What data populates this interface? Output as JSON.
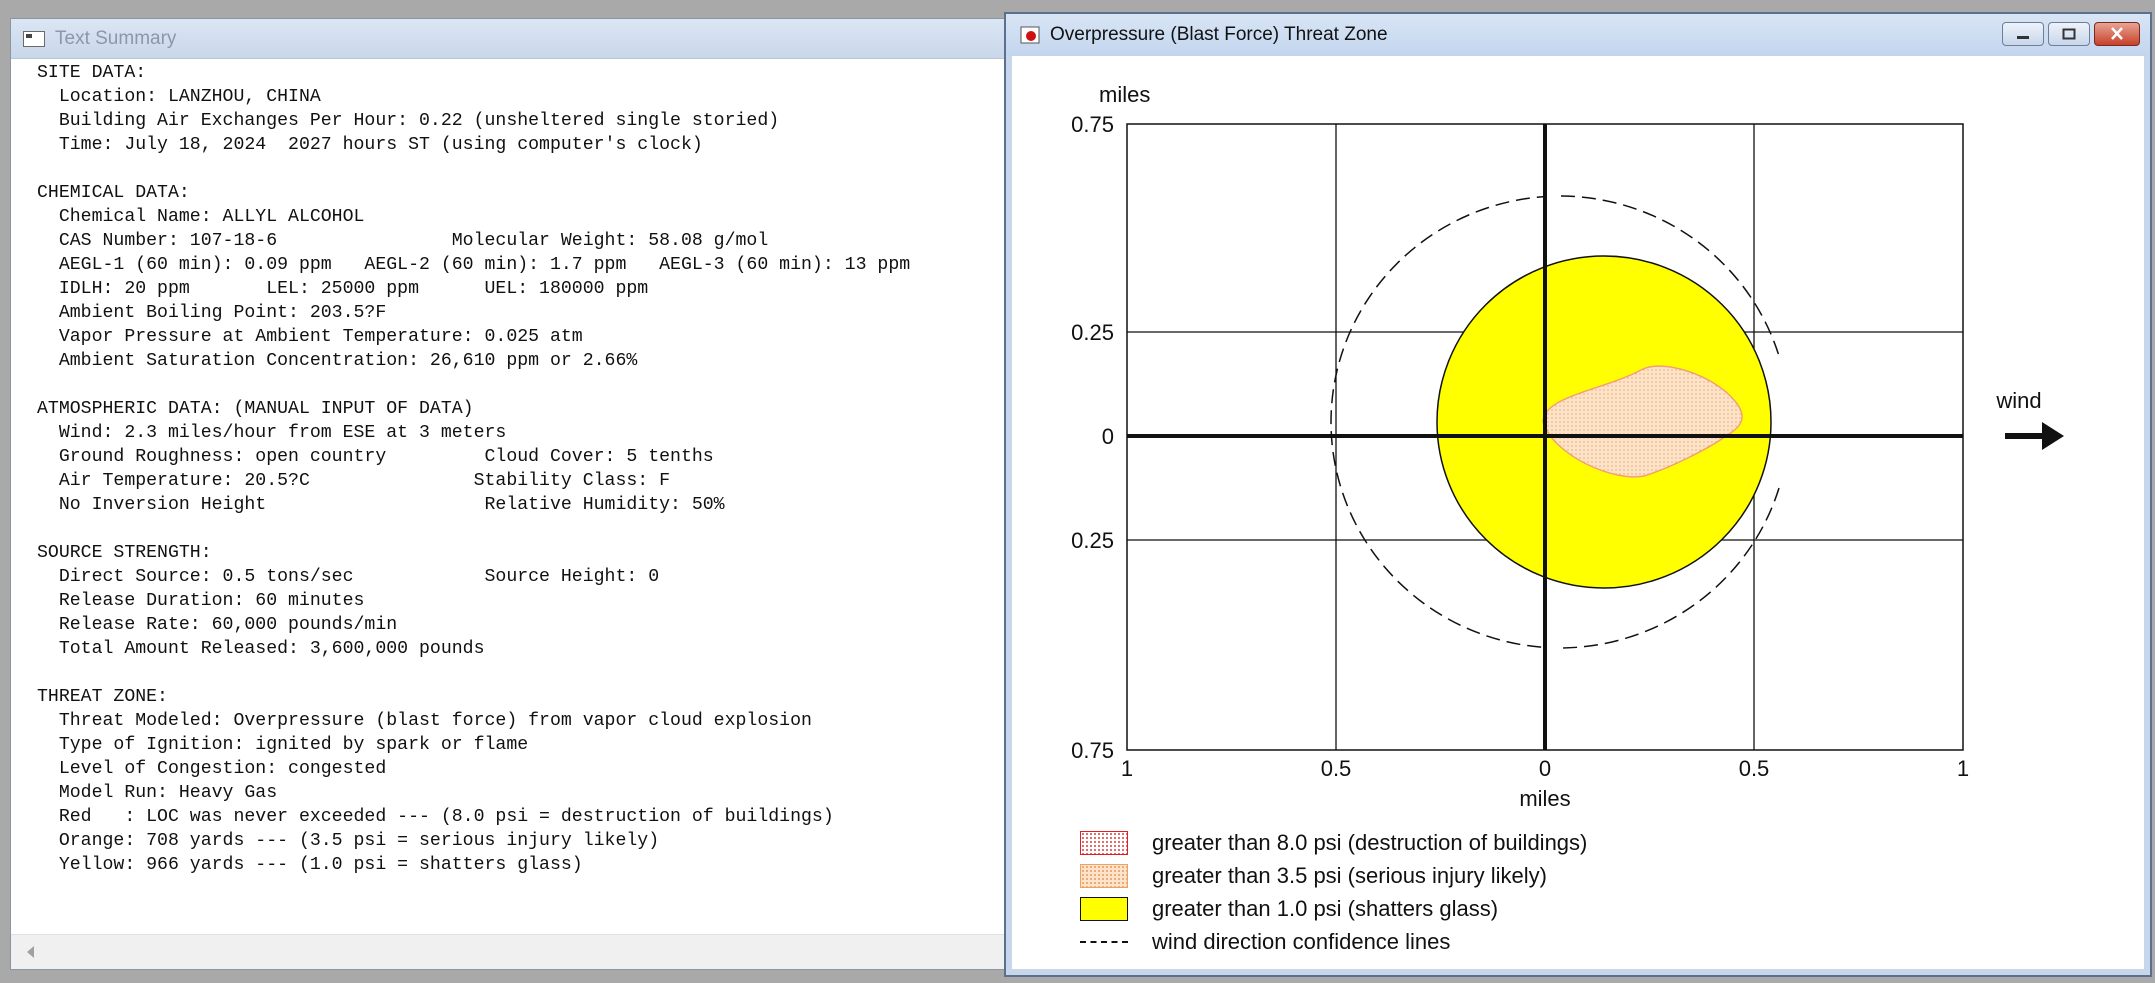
{
  "text_summary": {
    "title": "Text Summary",
    "sections": [
      {
        "lines": [
          "SITE DATA:",
          "  Location: LANZHOU, CHINA",
          "  Building Air Exchanges Per Hour: 0.22 (unsheltered single storied)",
          "  Time: July 18, 2024  2027 hours ST (using computer's clock)"
        ]
      },
      {
        "lines": [
          "CHEMICAL DATA:",
          "  Chemical Name: ALLYL ALCOHOL",
          "  CAS Number: 107-18-6                Molecular Weight: 58.08 g/mol",
          "  AEGL-1 (60 min): 0.09 ppm   AEGL-2 (60 min): 1.7 ppm   AEGL-3 (60 min): 13 ppm",
          "  IDLH: 20 ppm       LEL: 25000 ppm      UEL: 180000 ppm",
          "  Ambient Boiling Point: 203.5?F",
          "  Vapor Pressure at Ambient Temperature: 0.025 atm",
          "  Ambient Saturation Concentration: 26,610 ppm or 2.66%"
        ]
      },
      {
        "lines": [
          "ATMOSPHERIC DATA: (MANUAL INPUT OF DATA)",
          "  Wind: 2.3 miles/hour from ESE at 3 meters",
          "  Ground Roughness: open country         Cloud Cover: 5 tenths",
          "  Air Temperature: 20.5?C               Stability Class: F",
          "  No Inversion Height                    Relative Humidity: 50%"
        ]
      },
      {
        "lines": [
          "SOURCE STRENGTH:",
          "  Direct Source: 0.5 tons/sec            Source Height: 0",
          "  Release Duration: 60 minutes",
          "  Release Rate: 60,000 pounds/min",
          "  Total Amount Released: 3,600,000 pounds"
        ]
      },
      {
        "lines": [
          "THREAT ZONE:",
          "  Threat Modeled: Overpressure (blast force) from vapor cloud explosion",
          "  Type of Ignition: ignited by spark or flame",
          "  Level of Congestion: congested",
          "  Model Run: Heavy Gas",
          "  Red   : LOC was never exceeded --- (8.0 psi = destruction of buildings)",
          "  Orange: 708 yards --- (3.5 psi = serious injury likely)",
          "  Yellow: 966 yards --- (1.0 psi = shatters glass)"
        ]
      }
    ]
  },
  "threat_zone": {
    "title": "Overpressure (Blast Force) Threat Zone",
    "y_unit": "miles",
    "x_unit": "miles",
    "wind_label": "wind",
    "y_ticks": [
      "0.75",
      "0.25",
      "0",
      "0.25",
      "0.75"
    ],
    "x_ticks": [
      "1",
      "0.5",
      "0",
      "0.5",
      "1"
    ],
    "legend": [
      {
        "label": "greater than 8.0 psi (destruction of buildings)"
      },
      {
        "label": "greater than 3.5 psi (serious injury likely)"
      },
      {
        "label": "greater than 1.0 psi (shatters glass)"
      },
      {
        "label": "wind direction confidence lines"
      }
    ],
    "colors": {
      "yellow_zone": "#ffff00",
      "orange_zone": "#fde4c8",
      "red_outline": "#e02020"
    }
  }
}
